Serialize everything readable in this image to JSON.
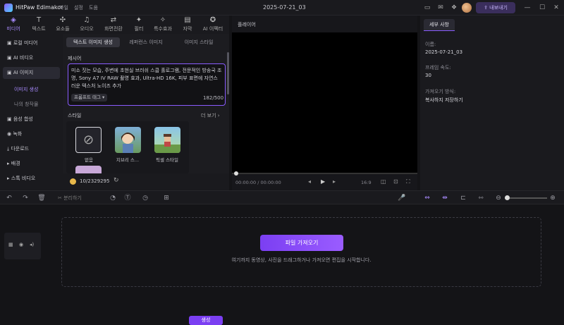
{
  "app": {
    "name": "HitPaw Edimakor",
    "menu": [
      "파일",
      "설정",
      "도움"
    ],
    "project_title": "2025-07-21_03",
    "export_label": "내보내기"
  },
  "toolbar": [
    "미디어",
    "텍스트",
    "요소들",
    "오디오",
    "화면전환",
    "필터",
    "특수효과",
    "자막",
    "AI 이펙터"
  ],
  "sidebar": {
    "items": [
      "로컬 미디어",
      "AI 비디오",
      "AI 이미지",
      "음성 합성",
      "녹화",
      "다운로드",
      "배경",
      "스톡 비디오"
    ],
    "subitems": [
      "이미지 생성",
      "나의 창작물"
    ]
  },
  "panel": {
    "tabs": [
      "텍스트 이미지 생성",
      "레퍼런스 이미지",
      "이미지 스타일"
    ],
    "prompt_label": "제시어",
    "prompt_text": "미소 짓는 모습, 주변에 초현실 브러쉬 스쿱 홀로그램, 전문적인 방송국 조명, Sony A7 IV RAW 촬영 효과, Ultra-HD 16K, 피부 표면에 자연스러운 텍스처 노이즈 추가",
    "prompt_tag": "프롬프트 태그",
    "char_count": "182/500",
    "style_label": "스타일",
    "more": "더 보기",
    "styles": [
      "없음",
      "지브리 스...",
      "픽셀 스타일"
    ],
    "credits": "10/2329295",
    "generate": "생성"
  },
  "player": {
    "title": "플레이어",
    "time": "00:00:00 / 00:00:00",
    "ratio": "16:9"
  },
  "props": {
    "tab": "세부 사항",
    "name_label": "이름:",
    "name": "2025-07-21_03",
    "fps_label": "프레임 속도:",
    "fps": "30",
    "import_label": "가져오기 방식:",
    "import_mode": "복사하지 저장하기"
  },
  "timeline": {
    "split_label": "분리하기",
    "import_button": "파일 가져오기",
    "hint": "여기까지 동영상, 사진을 드래그하거나 가져오면 편집을 시작합니다."
  },
  "colors": {
    "accent": "#8a5cff",
    "button": "#7b3ff2"
  }
}
